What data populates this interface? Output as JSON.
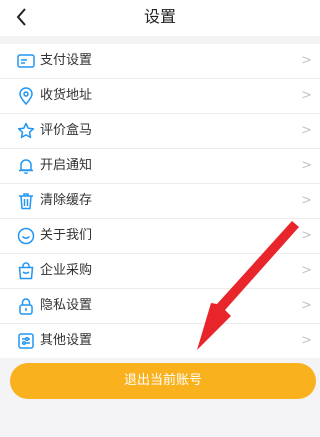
{
  "header": {
    "title": "设置",
    "back_icon": "chevron-left-icon"
  },
  "settings": {
    "items": [
      {
        "label": "支付设置",
        "icon": "card-icon"
      },
      {
        "label": "收货地址",
        "icon": "location-pin-icon"
      },
      {
        "label": "评价盒马",
        "icon": "star-icon"
      },
      {
        "label": "开启通知",
        "icon": "bell-icon"
      },
      {
        "label": "清除缓存",
        "icon": "trash-icon"
      },
      {
        "label": "关于我们",
        "icon": "smile-icon"
      },
      {
        "label": "企业采购",
        "icon": "shopping-bag-icon"
      },
      {
        "label": "隐私设置",
        "icon": "lock-icon"
      },
      {
        "label": "其他设置",
        "icon": "sliders-icon"
      }
    ]
  },
  "logout": {
    "label": "退出当前账号"
  },
  "colors": {
    "accent_icon": "#2196f3",
    "button": "#f9b21d",
    "annotation_arrow": "#e8252b"
  }
}
